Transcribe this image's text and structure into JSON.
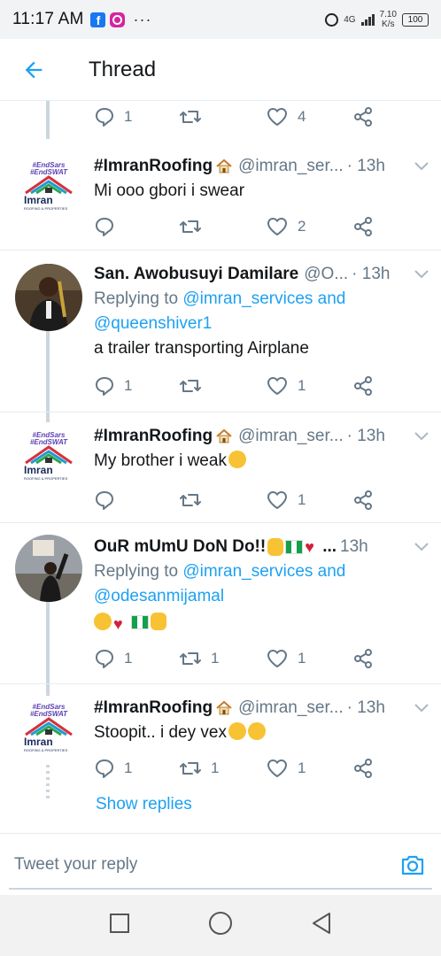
{
  "status_bar": {
    "time": "11:17 AM",
    "network": "4G",
    "speed_value": "7.10",
    "speed_unit": "K/s",
    "battery": "100"
  },
  "header": {
    "title": "Thread"
  },
  "top_actions": {
    "reply_count": "1",
    "like_count": "4"
  },
  "tweets": [
    {
      "name": "#ImranRoofing",
      "handle": "@imran_ser...",
      "time": "· 13h",
      "text": "Mi ooo gbori i swear",
      "replies": "",
      "retweets": "",
      "likes": "2"
    },
    {
      "name": "San. Awobusuyi Damilare",
      "handle": "@O...",
      "time": "· 13h",
      "reply_prefix": "Replying to ",
      "reply_handle_1": "@imran_services",
      "reply_and": " and",
      "reply_handle_2": "@queenshiver1",
      "text": "a trailer transporting Airplane",
      "replies": "1",
      "retweets": "",
      "likes": "1"
    },
    {
      "name": "#ImranRoofing",
      "handle": "@imran_ser...",
      "time": "· 13h",
      "text": "My brother i weak",
      "replies": "",
      "retweets": "",
      "likes": "1"
    },
    {
      "name": "OuR mUmU DoN Do!!",
      "handle": "...",
      "time": "13h",
      "reply_prefix": "Replying to ",
      "reply_handle_1": "@imran_services",
      "reply_and": " and",
      "reply_handle_2": "@odesanmijamal",
      "text": "",
      "replies": "1",
      "retweets": "1",
      "likes": "1"
    },
    {
      "name": "#ImranRoofing",
      "handle": "@imran_ser...",
      "time": "· 13h",
      "text": "Stoopit.. i dey vex",
      "replies": "1",
      "retweets": "1",
      "likes": "1"
    }
  ],
  "avatar_badge": {
    "line1": "#EndSars",
    "line2": "#EndSWAT",
    "brand": "Imran",
    "tag": "ROOFING & PROPERTIES"
  },
  "show_replies": "Show replies",
  "compose": {
    "placeholder": "Tweet your reply"
  },
  "colors": {
    "accent": "#1da1f2",
    "muted": "#657786",
    "line": "#ccd6dd"
  },
  "icons": [
    "facebook-icon",
    "instagram-icon",
    "alarm-icon",
    "signal-icon",
    "battery-icon",
    "back-arrow-icon",
    "reply-icon",
    "retweet-icon",
    "like-icon",
    "share-icon",
    "chevron-down-icon",
    "camera-icon",
    "home-square-icon",
    "circle-icon",
    "back-triangle-icon"
  ]
}
